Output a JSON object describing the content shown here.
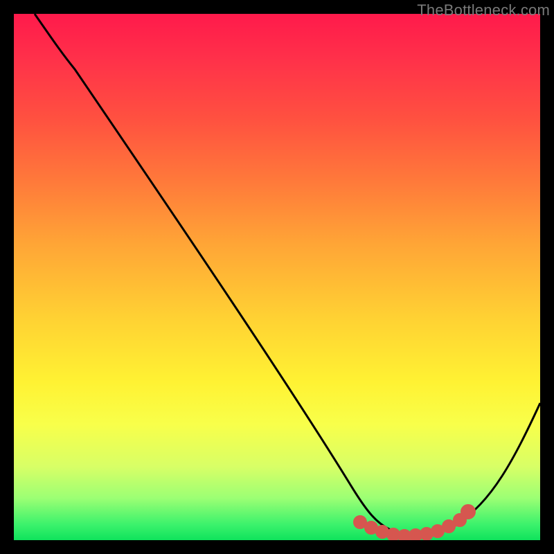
{
  "watermark": "TheBottleneck.com",
  "chart_data": {
    "type": "line",
    "title": "",
    "xlabel": "",
    "ylabel": "",
    "xlim": [
      0,
      100
    ],
    "ylim": [
      0,
      100
    ],
    "grid": false,
    "legend": false,
    "series": [
      {
        "name": "bottleneck-curve",
        "x": [
          0,
          6,
          12,
          18,
          24,
          30,
          36,
          42,
          48,
          54,
          60,
          64,
          68,
          72,
          76,
          80,
          84,
          88,
          92,
          96,
          100
        ],
        "y": [
          100,
          96,
          91,
          84,
          76,
          68,
          59,
          50,
          41,
          32,
          23,
          16,
          9,
          4,
          2,
          1,
          2,
          5,
          11,
          19,
          29
        ]
      }
    ],
    "markers": {
      "name": "highlight-segment",
      "color": "#d6564f",
      "x": [
        68,
        70,
        72,
        74,
        76,
        78,
        80,
        82,
        84,
        86
      ],
      "y": [
        4.0,
        3.0,
        2.2,
        1.6,
        1.2,
        1.1,
        1.3,
        1.8,
        2.6,
        4.2
      ]
    },
    "colors": {
      "curve": "#000000",
      "marker": "#d6564f",
      "background_top": "#ff1a4b",
      "background_bottom": "#0fe35c"
    }
  }
}
